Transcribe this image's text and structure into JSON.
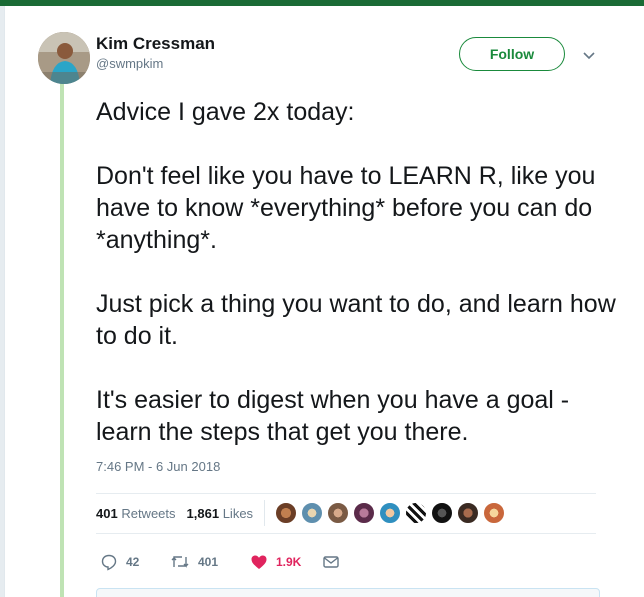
{
  "tweet": {
    "author_name": "Kim Cressman",
    "author_handle": "@swmpkim",
    "follow_label": "Follow",
    "paragraphs": [
      "Advice I gave 2x today:",
      "Don't feel like you have to LEARN R, like you have to know *everything* before you can do *anything*.",
      "Just pick a thing you want to do, and learn how to do it.",
      "It's easier to digest when you have a goal - learn the steps that get you there."
    ],
    "timestamp": "7:46 PM - 6 Jun 2018"
  },
  "stats": {
    "retweets_count": "401",
    "retweets_label": "Retweets",
    "likes_count": "1,861",
    "likes_label": "Likes"
  },
  "actions": {
    "reply_count": "42",
    "retweet_count": "401",
    "like_count": "1.9K"
  },
  "icons": {
    "caret": "chevron-down-icon",
    "reply": "reply-icon",
    "retweet": "retweet-icon",
    "like": "heart-icon",
    "dm": "envelope-icon"
  },
  "colors": {
    "accent_green": "#1a8a3c",
    "like_red": "#e0245e",
    "thread_line": "#bfe3b4",
    "top_bar": "#1a6b35"
  }
}
